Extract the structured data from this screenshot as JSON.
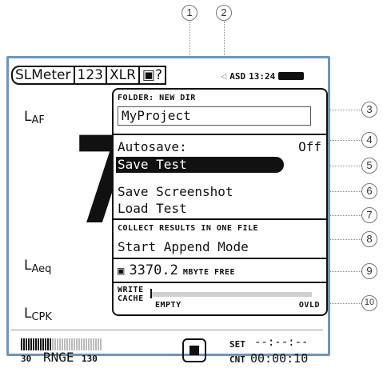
{
  "status_bar": {
    "tabs": [
      "SLMeter",
      "123",
      "XLR",
      "▣?"
    ],
    "speaker_icon": "speaker-icon",
    "mode": "ASD",
    "time": "13:24",
    "battery_icon": "battery-icon"
  },
  "measurements": {
    "laf": {
      "main": "L",
      "sub": "AF"
    },
    "laeq": {
      "main": "L",
      "sub": "Aeq"
    },
    "lcpk": {
      "main": "L",
      "sub": "CPK"
    },
    "big_value": "7"
  },
  "menu": {
    "folder_label": "FOLDER: NEW DIR",
    "folder_value": "MyProject",
    "autosave_label": "Autosave:",
    "autosave_value": "Off",
    "save_test": "Save Test",
    "save_screenshot": "Save Screenshot",
    "load_test": "Load Test",
    "collect_label": "COLLECT RESULTS IN ONE FILE",
    "start_append": "Start Append Mode",
    "free_space": "3370.2",
    "free_unit": "MBYTE FREE",
    "write_label": "WRITE",
    "cache_label": "CACHE",
    "cache_state": "EMPTY",
    "cache_ovld": "OVLD",
    "cache_fill": 0.0
  },
  "bottom": {
    "range_low": "30",
    "range_label": "RNGE",
    "range_high": "130",
    "set_label": "SET",
    "set_value": "--:--:--",
    "cnt_label": "CNT",
    "cnt_value": "00:00:10"
  },
  "callouts": [
    "1",
    "2",
    "3",
    "4",
    "5",
    "6",
    "7",
    "8",
    "9",
    "10"
  ]
}
